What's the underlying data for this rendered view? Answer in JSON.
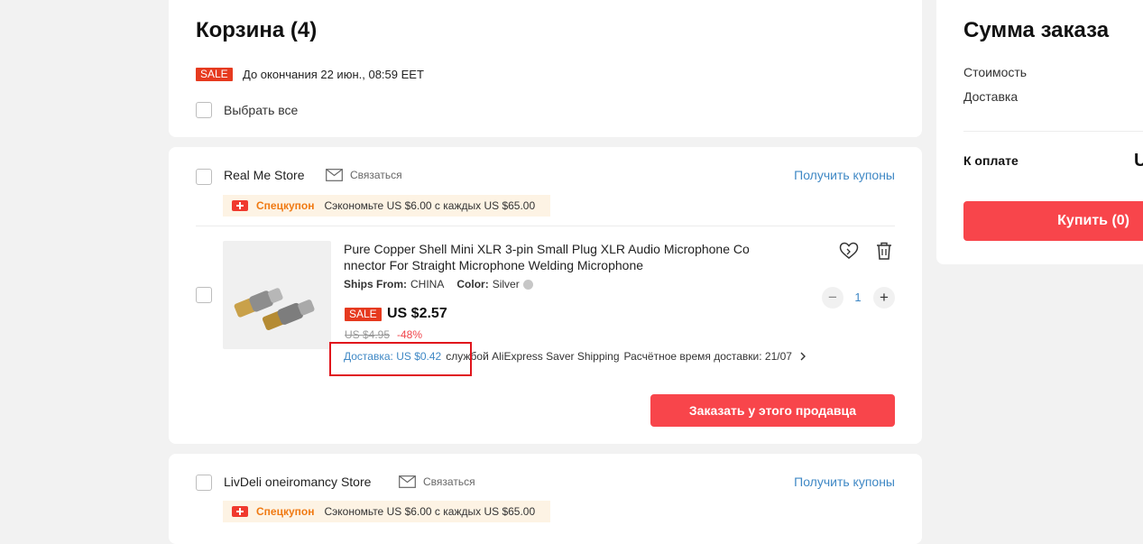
{
  "cart": {
    "title": "Корзина (4)",
    "sale_badge": "SALE",
    "sale_deadline": "До окончания 22 июн., 08:59 EET",
    "select_all": "Выбрать все"
  },
  "stores": [
    {
      "name": "Real Me Store",
      "contact_label": "Связаться",
      "get_coupons": "Получить купоны",
      "coupon_label": "Спецкупон",
      "coupon_text": "Сэкономьте US $6.00 с каждых US $65.00",
      "product": {
        "title_line1": "Pure Copper Shell Mini XLR 3-pin Small Plug XLR Audio Microphone Co",
        "title_line2": "nnector For Straight Microphone Welding Microphone",
        "ships_from_label": "Ships From:",
        "ships_from_value": "CHINA",
        "color_label": "Color:",
        "color_value": "Silver",
        "sale_badge": "SALE",
        "price": "US $2.57",
        "old_price": "US $4.95",
        "discount": "-48%",
        "shipping_price": "Доставка: US $0.42",
        "shipping_service": "службой AliExpress Saver Shipping",
        "delivery_estimate": "Расчётное время доставки: 21/07",
        "quantity": "1",
        "minus": "−",
        "plus": "+"
      },
      "order_button": "Заказать у этого продавца"
    },
    {
      "name": "LivDeli oneiromancy Store",
      "contact_label": "Связаться",
      "get_coupons": "Получить купоны",
      "coupon_label": "Спецкупон",
      "coupon_text": "Сэкономьте US $6.00 с каждых US $65.00"
    }
  ],
  "summary": {
    "title": "Сумма заказа",
    "cost_label": "Стоимость",
    "shipping_label": "Доставка",
    "total_label": "К оплате",
    "total_value_partial": "U",
    "buy_button": "Купить (0)"
  },
  "colors": {
    "accent_red": "#f8454b",
    "sale_red": "#e63a1f",
    "link_blue": "#3f88c5",
    "coupon_orange": "#f07a13",
    "highlight_box": "#e0141c"
  }
}
